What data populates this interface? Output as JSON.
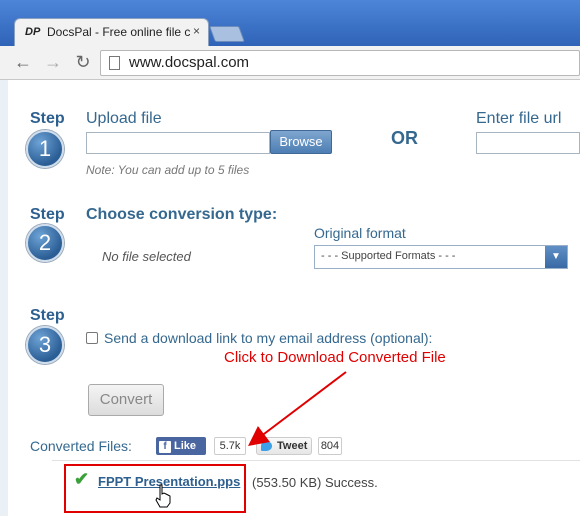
{
  "browser": {
    "tab_logo": "DP",
    "tab_title": "DocsPal - Free online file c",
    "tab_close": "×",
    "url": "www.docspal.com",
    "back": "←",
    "forward": "→",
    "reload": "↻"
  },
  "step1": {
    "step_label": "Step",
    "number": "1",
    "upload_label": "Upload file",
    "browse_label": "Browse",
    "note": "Note: You can add up to 5 files",
    "or_label": "OR",
    "url_label": "Enter file url"
  },
  "step2": {
    "step_label": "Step",
    "number": "2",
    "heading": "Choose conversion type:",
    "no_file": "No file selected",
    "format_label": "Original format",
    "format_selected": "- - - Supported Formats - - -"
  },
  "step3": {
    "step_label": "Step",
    "number": "3",
    "email_checkbox_label": "Send a download link to my email address (optional):",
    "convert_label": "Convert"
  },
  "annotation": {
    "text": "Click to Download Converted File",
    "color": "#e00000"
  },
  "converted": {
    "label": "Converted Files:",
    "like_label": "Like",
    "like_count": "5.7k",
    "tweet_label": "Tweet",
    "tweet_count": "804",
    "file_name": "FPPT Presentation.pps",
    "file_result": "(553.50 KB) Success."
  },
  "colors": {
    "accent": "#35688f",
    "step_circle": "#2a5e95",
    "success": "#3aa13a"
  }
}
